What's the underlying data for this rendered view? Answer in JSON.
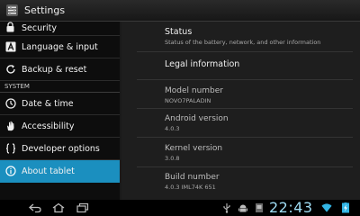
{
  "actionbar": {
    "title": "Settings",
    "icon": "settings-icon"
  },
  "sidebar": {
    "items_top": [
      {
        "label": "Security",
        "icon": "lock-icon"
      },
      {
        "label": "Language & input",
        "icon": "keyboard-icon"
      },
      {
        "label": "Backup & reset",
        "icon": "refresh-icon"
      }
    ],
    "section_system": "SYSTEM",
    "items_system": [
      {
        "label": "Date & time",
        "icon": "clock-icon"
      },
      {
        "label": "Accessibility",
        "icon": "hand-icon"
      },
      {
        "label": "Developer options",
        "icon": "braces-icon"
      },
      {
        "label": "About tablet",
        "icon": "info-icon",
        "selected": true
      }
    ]
  },
  "about": {
    "status": {
      "title": "Status",
      "summary": "Status of the battery, network, and other information"
    },
    "legal": {
      "title": "Legal information"
    },
    "model": {
      "title": "Model number",
      "value": "NOVO7PALADIN"
    },
    "android": {
      "title": "Android version",
      "value": "4.0.3"
    },
    "kernel": {
      "title": "Kernel version",
      "value": "3.0.8"
    },
    "build": {
      "title": "Build number",
      "value": "4.0.3 IML74K 651"
    }
  },
  "navbar": {
    "clock": "22:43",
    "buttons": [
      "back-icon",
      "home-icon",
      "recent-apps-icon"
    ],
    "status_icons": [
      "usb-icon",
      "android-debug-icon",
      "sd-card-icon",
      "wifi-icon",
      "battery-icon"
    ]
  },
  "colors": {
    "accent": "#1b8fbf",
    "clock": "#9fdcf4"
  }
}
